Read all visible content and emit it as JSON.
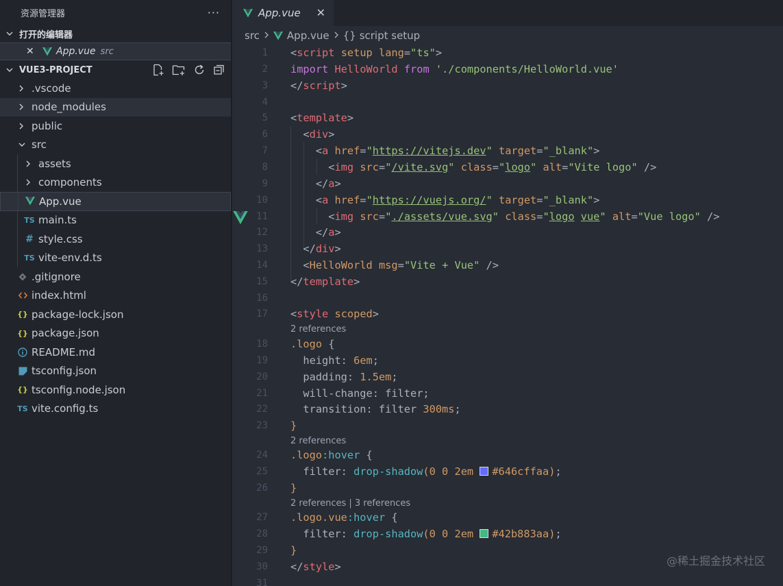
{
  "explorer": {
    "title": "资源管理器",
    "more": "···",
    "open_editors_label": "打开的编辑器",
    "open_editor": {
      "close": "✕",
      "name": "App.vue",
      "path": "src"
    },
    "project_label": "VUE3-PROJECT",
    "tree": [
      {
        "label": ".vscode"
      },
      {
        "label": "node_modules"
      },
      {
        "label": "public"
      },
      {
        "label": "src"
      },
      {
        "label": "assets"
      },
      {
        "label": "components"
      },
      {
        "label": "App.vue"
      },
      {
        "label": "main.ts",
        "icon": "TS"
      },
      {
        "label": "style.css",
        "icon": "#"
      },
      {
        "label": "vite-env.d.ts",
        "icon": "TS"
      },
      {
        "label": ".gitignore"
      },
      {
        "label": "index.html"
      },
      {
        "label": "package-lock.json",
        "icon": "{}"
      },
      {
        "label": "package.json",
        "icon": "{}"
      },
      {
        "label": "README.md"
      },
      {
        "label": "tsconfig.json"
      },
      {
        "label": "tsconfig.node.json",
        "icon": "{}"
      },
      {
        "label": "vite.config.ts",
        "icon": "TS"
      }
    ]
  },
  "tab": {
    "label": "App.vue",
    "close": "✕"
  },
  "breadcrumb": {
    "folder": "src",
    "file": "App.vue",
    "symbol": "script setup"
  },
  "editor": {
    "line_numbers": [
      "1",
      "2",
      "3",
      "4",
      "5",
      "6",
      "7",
      "8",
      "9",
      "10",
      "11",
      "12",
      "13",
      "14",
      "15",
      "16",
      "17",
      "18",
      "19",
      "20",
      "21",
      "22",
      "23",
      "24",
      "25",
      "26",
      "27",
      "28",
      "29",
      "30",
      "31"
    ],
    "code_lens": [
      "2 references",
      "2 references",
      "2 references | 3 references"
    ],
    "swatch_colors": [
      "#646cff",
      "#42b883"
    ]
  },
  "colors": {
    "accent": "#41b883",
    "sidebar_bg": "#21252b",
    "editor_bg": "#282c34"
  },
  "watermark": "@稀土掘金技术社区"
}
